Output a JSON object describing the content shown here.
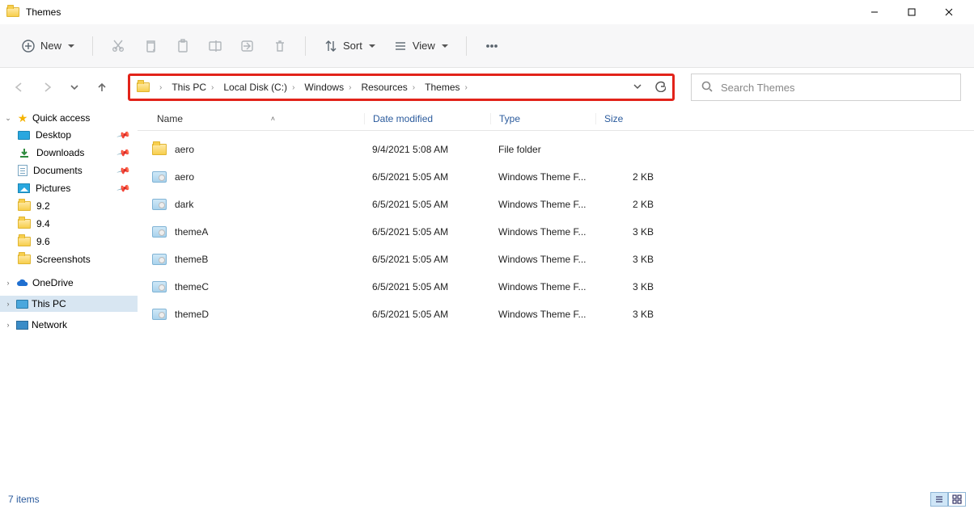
{
  "window": {
    "title": "Themes"
  },
  "toolbar": {
    "new_label": "New",
    "sort_label": "Sort",
    "view_label": "View"
  },
  "breadcrumb": [
    "This PC",
    "Local Disk (C:)",
    "Windows",
    "Resources",
    "Themes"
  ],
  "search": {
    "placeholder": "Search Themes"
  },
  "columns": {
    "name": "Name",
    "date": "Date modified",
    "type": "Type",
    "size": "Size"
  },
  "quick_access": {
    "label": "Quick access",
    "items": [
      {
        "label": "Desktop",
        "icon": "desktop",
        "pinned": true
      },
      {
        "label": "Downloads",
        "icon": "download",
        "pinned": true
      },
      {
        "label": "Documents",
        "icon": "doc",
        "pinned": true
      },
      {
        "label": "Pictures",
        "icon": "pic",
        "pinned": true
      },
      {
        "label": "9.2",
        "icon": "folder",
        "pinned": false
      },
      {
        "label": "9.4",
        "icon": "folder",
        "pinned": false
      },
      {
        "label": "9.6",
        "icon": "folder",
        "pinned": false
      },
      {
        "label": "Screenshots",
        "icon": "folder",
        "pinned": false
      }
    ]
  },
  "nav_nodes": [
    {
      "label": "OneDrive",
      "icon": "cloud"
    },
    {
      "label": "This PC",
      "icon": "pc",
      "selected": true
    },
    {
      "label": "Network",
      "icon": "net"
    }
  ],
  "files": [
    {
      "name": "aero",
      "date": "9/4/2021 5:08 AM",
      "type": "File folder",
      "size": "",
      "icon": "folder"
    },
    {
      "name": "aero",
      "date": "6/5/2021 5:05 AM",
      "type": "Windows Theme F...",
      "size": "2 KB",
      "icon": "theme"
    },
    {
      "name": "dark",
      "date": "6/5/2021 5:05 AM",
      "type": "Windows Theme F...",
      "size": "2 KB",
      "icon": "theme"
    },
    {
      "name": "themeA",
      "date": "6/5/2021 5:05 AM",
      "type": "Windows Theme F...",
      "size": "3 KB",
      "icon": "theme"
    },
    {
      "name": "themeB",
      "date": "6/5/2021 5:05 AM",
      "type": "Windows Theme F...",
      "size": "3 KB",
      "icon": "theme"
    },
    {
      "name": "themeC",
      "date": "6/5/2021 5:05 AM",
      "type": "Windows Theme F...",
      "size": "3 KB",
      "icon": "theme"
    },
    {
      "name": "themeD",
      "date": "6/5/2021 5:05 AM",
      "type": "Windows Theme F...",
      "size": "3 KB",
      "icon": "theme"
    }
  ],
  "status": {
    "text": "7 items"
  }
}
